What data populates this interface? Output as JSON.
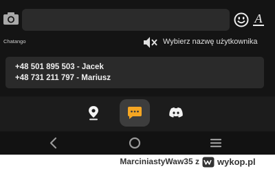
{
  "chat": {
    "input_placeholder": "",
    "brand": "Chatango",
    "username_prompt": "Wybierz nazwę użytkownika",
    "format_label": "A",
    "pinned_lines": [
      "+48 501 895 503 - Jacek",
      "+48 731 211 797 - Mariusz"
    ]
  },
  "app_nav": {
    "items": [
      {
        "icon": "location-pin-icon"
      },
      {
        "icon": "chat-bubble-icon",
        "active": true
      },
      {
        "icon": "discord-icon"
      }
    ]
  },
  "system_nav": {
    "items": [
      {
        "icon": "back-icon"
      },
      {
        "icon": "home-icon"
      },
      {
        "icon": "recent-apps-icon"
      }
    ]
  },
  "watermark": {
    "user": "MarciniastyWaw35",
    "separator": "z",
    "site": "wykop.pl"
  },
  "colors": {
    "background": "#131313",
    "input_bg": "#2b2b2b",
    "chat_icon": "#f5a623",
    "active_nav_bg": "#3d3d3d"
  }
}
